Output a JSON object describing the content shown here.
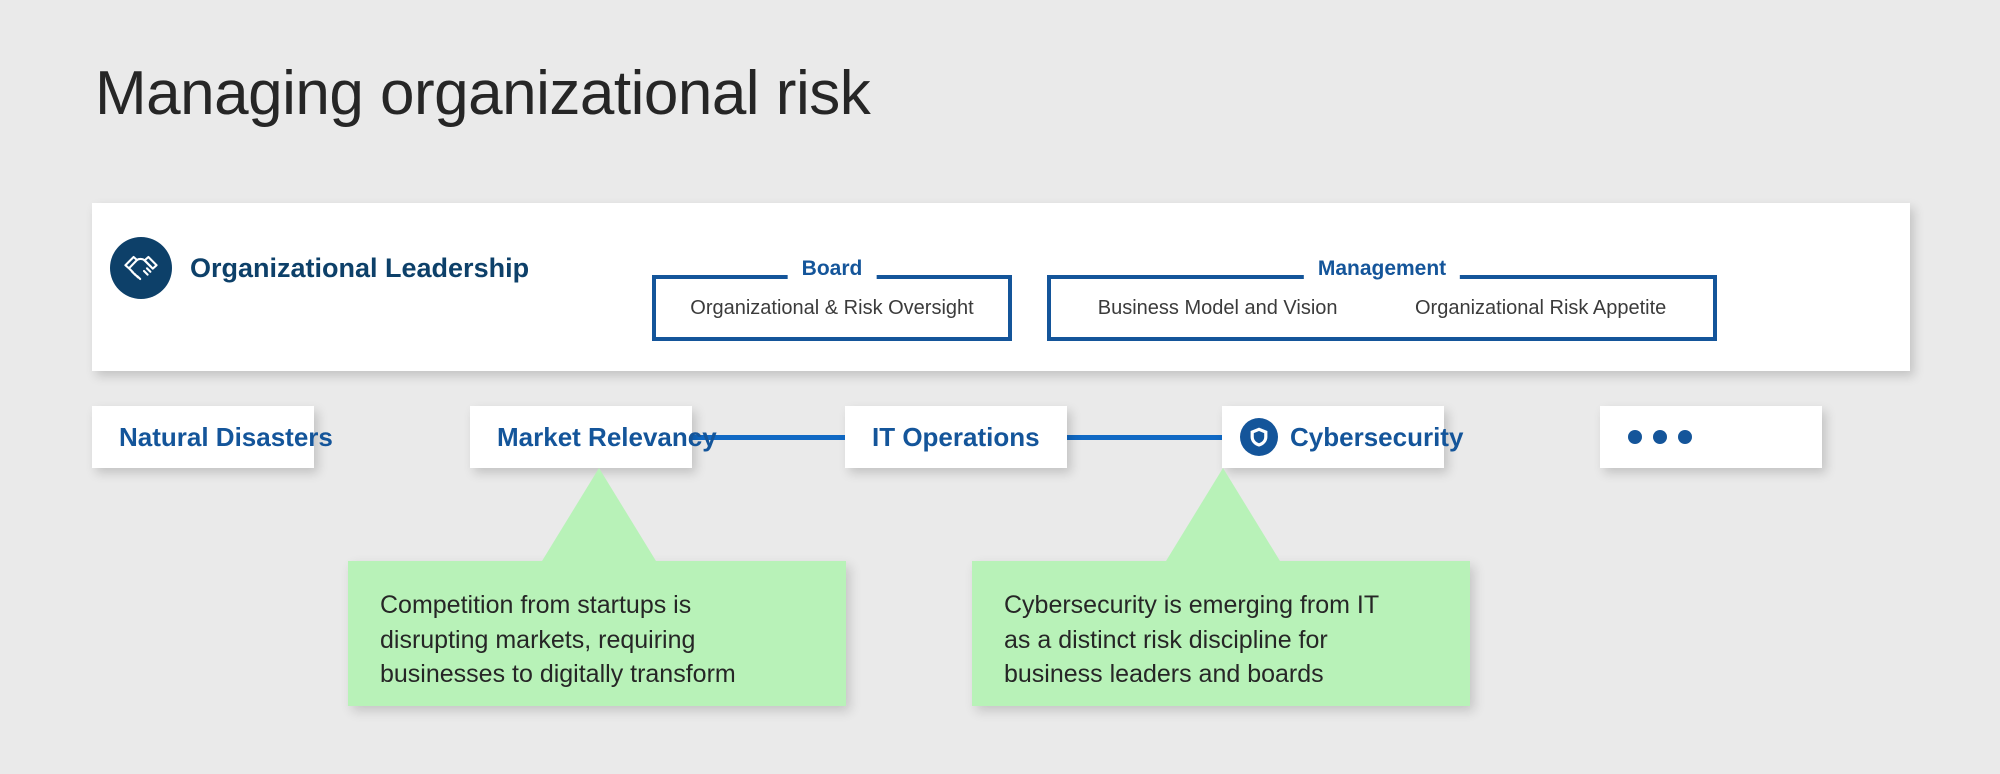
{
  "page": {
    "title": "Managing organizational risk",
    "background_color": "#eaeaea",
    "accent_blue": "#14559a",
    "dark_blue": "#0d4069",
    "callout_green": "#b8f2b8"
  },
  "leadership": {
    "icon": "handshake-icon",
    "label": "Organizational Leadership",
    "groups": [
      {
        "title": "Board",
        "items": [
          "Organizational & Risk Oversight"
        ]
      },
      {
        "title": "Management",
        "items": [
          "Business Model and Vision",
          "Organizational Risk Appetite"
        ]
      }
    ]
  },
  "risks": [
    {
      "label": "Natural Disasters",
      "icon": null
    },
    {
      "label": "Market Relevancy",
      "icon": null
    },
    {
      "label": "IT Operations",
      "icon": null
    },
    {
      "label": "Cybersecurity",
      "icon": "shield-icon"
    },
    {
      "label": "",
      "icon": "ellipsis-icon"
    }
  ],
  "callouts": [
    {
      "for": "Market Relevancy",
      "text": "Competition from startups is\ndisrupting markets, requiring\nbusinesses to digitally transform"
    },
    {
      "for": "Cybersecurity",
      "text": "Cybersecurity is emerging from IT\nas a distinct risk discipline for\nbusiness leaders and boards"
    }
  ]
}
